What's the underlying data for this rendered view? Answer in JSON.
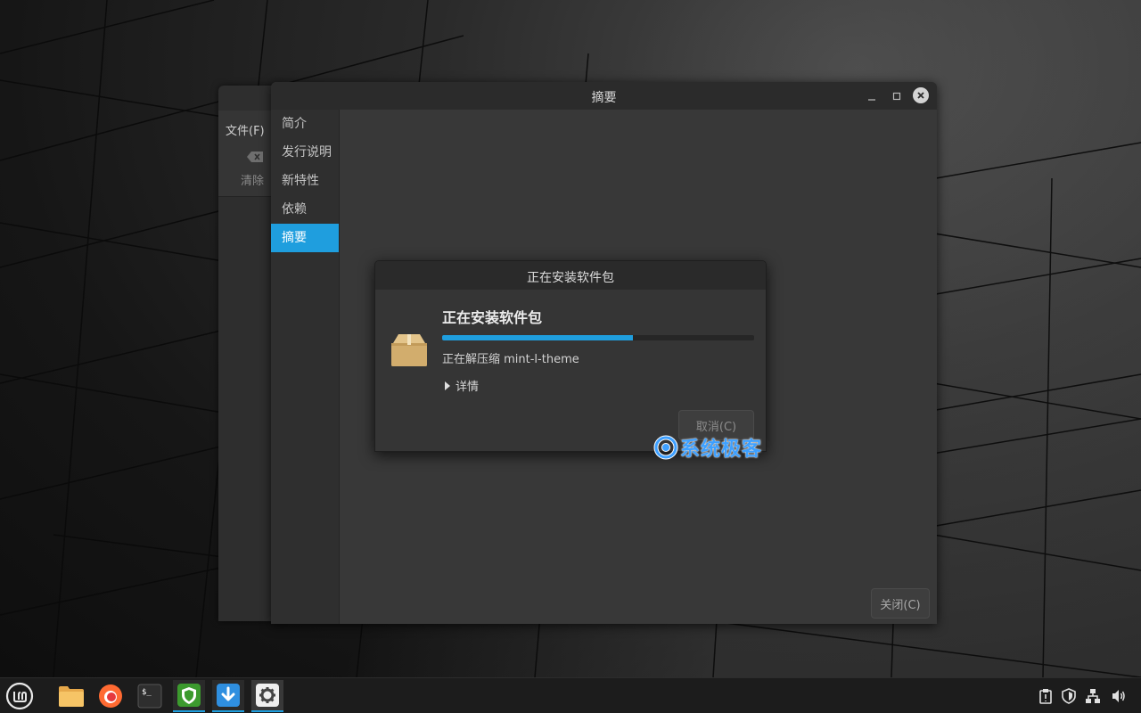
{
  "background_window": {
    "menu_file": "文件(F)",
    "clear_label": "清除"
  },
  "main_window": {
    "title": "摘要",
    "sidebar": {
      "items": [
        {
          "label": "简介"
        },
        {
          "label": "发行说明"
        },
        {
          "label": "新特性"
        },
        {
          "label": "依赖"
        },
        {
          "label": "摘要",
          "active": true
        }
      ]
    },
    "close_label": "关闭(C)"
  },
  "dialog": {
    "title": "正在安装软件包",
    "heading": "正在安装软件包",
    "progress_fraction": 0.61,
    "status": "正在解压缩 mint-l-theme",
    "details_label": "详情",
    "cancel_label": "取消(C)"
  },
  "watermark": {
    "text": "系统极客"
  },
  "taskbar": {
    "launchers": [
      {
        "icon": "files-icon"
      },
      {
        "icon": "firefox-icon"
      },
      {
        "icon": "terminal-icon"
      },
      {
        "icon": "update-manager-icon",
        "state": "running"
      },
      {
        "icon": "download-icon",
        "state": "running"
      },
      {
        "icon": "settings-gear-icon",
        "state": "active"
      }
    ],
    "tray": [
      "clipboard-icon",
      "shield-icon",
      "network-icon",
      "volume-icon"
    ]
  },
  "colors": {
    "accent": "#1f9ede",
    "window_bg": "#383838",
    "titlebar_bg": "#2b2b2b",
    "package_icon": "#d2ad6d"
  }
}
